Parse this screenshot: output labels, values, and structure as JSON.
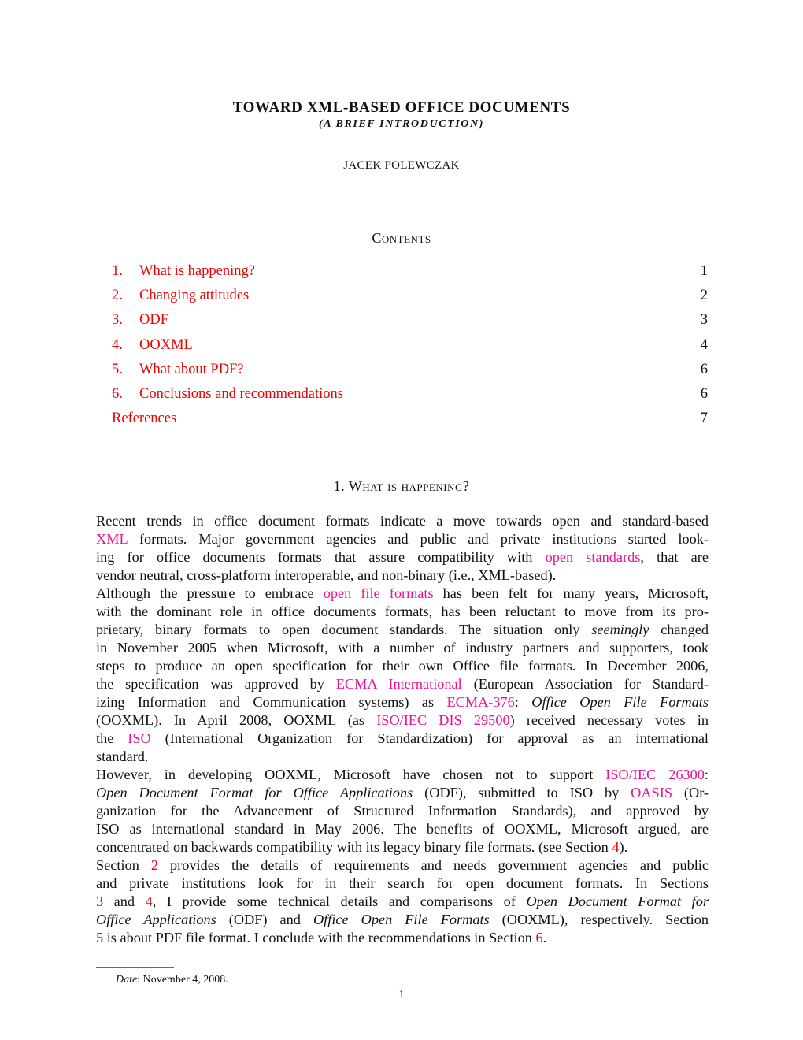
{
  "header": {
    "title": "TOWARD XML-BASED OFFICE DOCUMENTS",
    "subtitle": "(A BRIEF INTRODUCTION)",
    "author": "JACEK POLEWCZAK"
  },
  "contents": {
    "heading": "Contents",
    "entries": [
      {
        "number": "1.",
        "label": "What is happening?",
        "page": "1"
      },
      {
        "number": "2.",
        "label": "Changing attitudes",
        "page": "2"
      },
      {
        "number": "3.",
        "label": "ODF",
        "page": "3"
      },
      {
        "number": "4.",
        "label": "OOXML",
        "page": "4"
      },
      {
        "number": "5.",
        "label": "What about PDF?",
        "page": "6"
      },
      {
        "number": "6.",
        "label": "Conclusions and recommendations",
        "page": "6"
      },
      {
        "number": "",
        "label": "References",
        "page": "7"
      }
    ]
  },
  "section1": {
    "heading": "1. What is happening?",
    "p1": {
      "l1": "Recent trends in office document formats indicate a move towards open and standard-based",
      "l2_link": "XML",
      "l2": " formats. Major government agencies and public and private institutions started look-",
      "l3a": "ing for office documents formats that assure compatibility with ",
      "l3_link": "open standards",
      "l3b": ", that are",
      "l4": "vendor neutral, cross-platform interoperable, and non-binary (i.e., XML-based)."
    },
    "p2": {
      "l1a": "Although the pressure to embrace ",
      "l1_link": "open file formats",
      "l1b": " has been felt for many years, Microsoft,",
      "l2": "with the dominant role in office documents formats, has been reluctant to move from its pro-",
      "l3a": "prietary, binary formats to open document standards. The situation only ",
      "l3_em": "seemingly",
      "l3b": " changed",
      "l4": "in November 2005 when Microsoft, with a number of industry partners and supporters, took",
      "l5": "steps to produce an open specification for their own Office file formats. In December 2006,",
      "l6a": "the specification was approved by ",
      "l6_link": "ECMA International",
      "l6b": " (European Association for Standard-",
      "l7a": "izing Information and Communication systems) as ",
      "l7_link": "ECMA-376",
      "l7b": ": ",
      "l7_em": "Office Open File Formats",
      "l8a": "(OOXML). In April 2008, OOXML (as ",
      "l8_link": "ISO/IEC DIS 29500",
      "l8b": ") received necessary votes in",
      "l9a": "the ",
      "l9_link": "ISO",
      "l9b": " (International Organization for Standardization) for approval as an international",
      "l10": "standard."
    },
    "p3": {
      "l1a": "However, in developing OOXML, Microsoft have chosen not to support ",
      "l1_link": "ISO/IEC 26300",
      "l1b": ":",
      "l2_em": "Open Document Format for Office Applications",
      "l2a": " (ODF), submitted to ISO by ",
      "l2_link": "OASIS",
      "l2b": " (Or-",
      "l3": "ganization for the Advancement of Structured Information Standards), and approved by",
      "l4": "ISO as international standard in May 2006. The benefits of OOXML, Microsoft argued, are",
      "l5a": "concentrated on backwards compatibility with its legacy binary file formats. (see Section ",
      "l5_ref": "4",
      "l5b": ")."
    },
    "p4": {
      "l1a": "Section ",
      "l1_ref": "2",
      "l1b": " provides the details of requirements and needs government agencies and public",
      "l2": "and private institutions look for in their search for open document formats. In Sections",
      "l3_ref1": "3",
      "l3a": " and ",
      "l3_ref2": "4",
      "l3b": ", I provide some technical details and comparisons of ",
      "l3_em": "Open Document Format for",
      "l4_em1": "Office Applications",
      "l4a": " (ODF) and ",
      "l4_em2": "Office Open File Formats",
      "l4b": " (OOXML), respectively. Section",
      "l5_ref1": "5",
      "l5a": " is about PDF file format. I conclude with the recommendations in Section ",
      "l5_ref2": "6",
      "l5b": "."
    }
  },
  "footnote": {
    "label": "Date",
    "text": ": November 4, 2008."
  },
  "page_number": "1",
  "colors": {
    "internal_ref": "#ee0000",
    "url_link": "#ee1199",
    "text": "#111111"
  }
}
